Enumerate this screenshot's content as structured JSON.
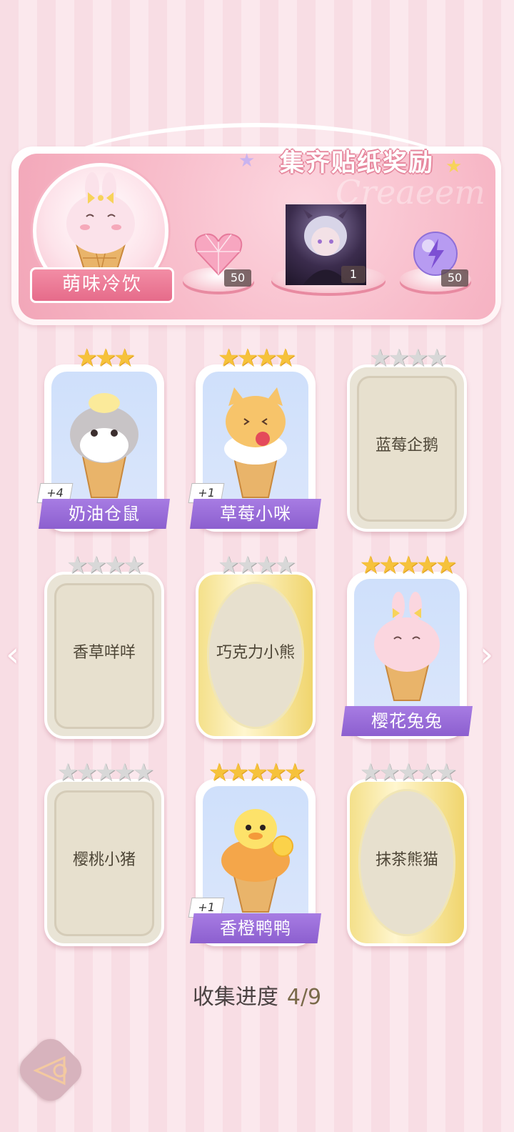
{
  "banner": {
    "title": "集齐贴纸奖励",
    "watermark": "Creaeem",
    "mascot_label": "萌味冷饮",
    "rewards": [
      {
        "icon": "pink-heart-gem-icon",
        "count": "50"
      },
      {
        "icon": "character-portrait",
        "count": "1"
      },
      {
        "icon": "purple-energy-orb-icon",
        "count": "50"
      }
    ]
  },
  "cards": [
    {
      "name": "奶油仓鼠",
      "stars_on": 3,
      "stars_total": 3,
      "owned": true,
      "plus": "+4",
      "style": "blue"
    },
    {
      "name": "草莓小咪",
      "stars_on": 4,
      "stars_total": 4,
      "owned": true,
      "plus": "+1",
      "style": "blue"
    },
    {
      "name": "蓝莓企鹅",
      "stars_on": 0,
      "stars_total": 4,
      "owned": false,
      "style": "empty"
    },
    {
      "name": "香草咩咩",
      "stars_on": 0,
      "stars_total": 4,
      "owned": false,
      "style": "empty"
    },
    {
      "name": "巧克力小熊",
      "stars_on": 0,
      "stars_total": 4,
      "owned": false,
      "style": "gold"
    },
    {
      "name": "樱花兔兔",
      "stars_on": 5,
      "stars_total": 5,
      "owned": true,
      "style": "blue"
    },
    {
      "name": "樱桃小猪",
      "stars_on": 0,
      "stars_total": 5,
      "owned": false,
      "style": "empty"
    },
    {
      "name": "香橙鸭鸭",
      "stars_on": 5,
      "stars_total": 5,
      "owned": true,
      "plus": "+1",
      "style": "blue"
    },
    {
      "name": "抹茶熊猫",
      "stars_on": 0,
      "stars_total": 5,
      "owned": false,
      "style": "gold"
    }
  ],
  "progress": {
    "label": "收集进度",
    "value": "4/9"
  },
  "nav": {
    "prev": "‹",
    "next": "›"
  },
  "colors": {
    "ribbon": "#e66b8a",
    "title_bar": "#8c5fcf",
    "star_on": "#f6c23b",
    "star_off": "#d8d8d8"
  }
}
